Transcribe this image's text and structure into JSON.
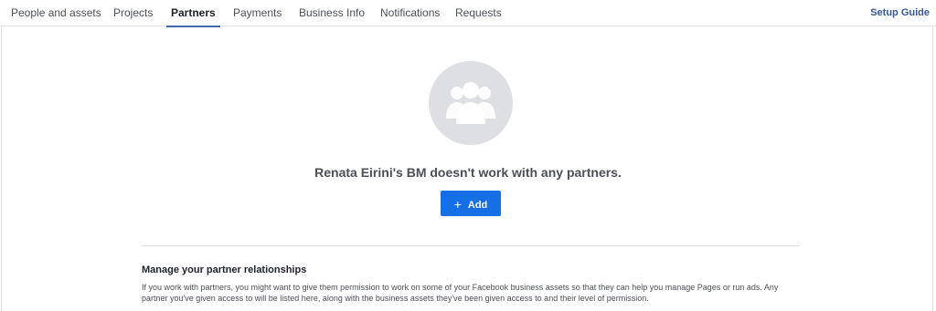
{
  "tabs": [
    {
      "label": "People and assets"
    },
    {
      "label": "Projects"
    },
    {
      "label": "Partners",
      "active": true
    },
    {
      "label": "Payments"
    },
    {
      "label": "Business Info"
    },
    {
      "label": "Notifications"
    },
    {
      "label": "Requests"
    }
  ],
  "setup_guide": "Setup Guide",
  "empty_state": {
    "icon": "people-group-icon",
    "message": "Renata Eirini's BM doesn't work with any partners.",
    "add_label": "Add",
    "add_icon": "plus-icon"
  },
  "info": {
    "title": "Manage your partner relationships",
    "body": "If you work with partners, you might want to give them permission to work on some of your Facebook business assets so that they can help you manage Pages or run ads. Any partner you've given access to will be listed here, along with the business assets they've been given access to and their level of permission."
  },
  "colors": {
    "accent": "#4267b2",
    "primary_button": "#166fe5",
    "link": "#365899",
    "icon_circle": "#dddfe2"
  }
}
